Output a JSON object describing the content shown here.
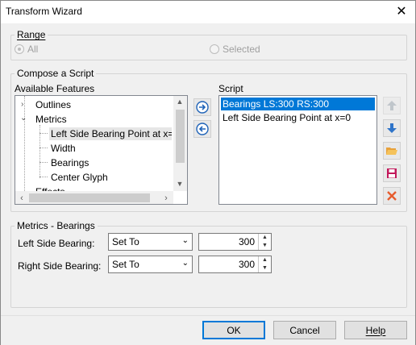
{
  "window": {
    "title": "Transform Wizard",
    "close_glyph": "✕"
  },
  "range": {
    "label": "Range",
    "options": [
      {
        "label": "All",
        "checked": true
      },
      {
        "label": "Selected",
        "checked": false
      }
    ]
  },
  "compose": {
    "label": "Compose a Script",
    "available_label": "Available Features",
    "script_label": "Script",
    "tree": {
      "outlines": "Outlines",
      "metrics": "Metrics",
      "left_side_bearing": "Left Side Bearing Point at x=",
      "width": "Width",
      "bearings": "Bearings",
      "center_glyph": "Center Glyph",
      "effects": "Effects"
    },
    "script_items": [
      "Bearings LS:300 RS:300",
      "Left Side Bearing Point at x=0"
    ]
  },
  "metrics_bearings": {
    "label": "Metrics - Bearings",
    "left": {
      "label": "Left Side Bearing:",
      "mode": "Set To",
      "value": "300"
    },
    "right": {
      "label": "Right Side Bearing:",
      "mode": "Set To",
      "value": "300"
    }
  },
  "buttons": {
    "ok": "OK",
    "cancel": "Cancel",
    "help": "Help"
  },
  "colors": {
    "accent": "#0078d7",
    "delete": "#e65c2e",
    "folder": "#e8a13a",
    "save": "#c2185b"
  }
}
